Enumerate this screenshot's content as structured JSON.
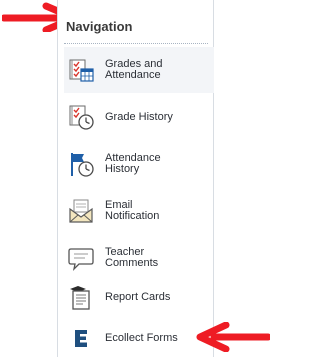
{
  "navigation": {
    "title": "Navigation",
    "items": [
      {
        "label": "Grades and\nAttendance",
        "icon": "gradebook-checklist-icon",
        "active": true
      },
      {
        "label": "Grade History",
        "icon": "gradebook-clock-icon",
        "active": false
      },
      {
        "label": "Attendance\nHistory",
        "icon": "flag-clock-icon",
        "active": false
      },
      {
        "label": "Email\nNotification",
        "icon": "envelope-icon",
        "active": false
      },
      {
        "label": "Teacher\nComments",
        "icon": "speech-bubble-icon",
        "active": false
      },
      {
        "label": "Report Cards",
        "icon": "report-card-icon",
        "active": false
      },
      {
        "label": "Ecollect Forms",
        "icon": "ecollect-e-icon",
        "active": false
      }
    ]
  },
  "annotations": {
    "arrow_color": "#ee1c24"
  },
  "colors": {
    "panel_border": "#d8dde3",
    "active_item_bg": "#f3f5f8",
    "label_text": "#2b2f36",
    "icon_blue": "#1f5fa8",
    "ecollect_blue": "#1f4f7f"
  }
}
